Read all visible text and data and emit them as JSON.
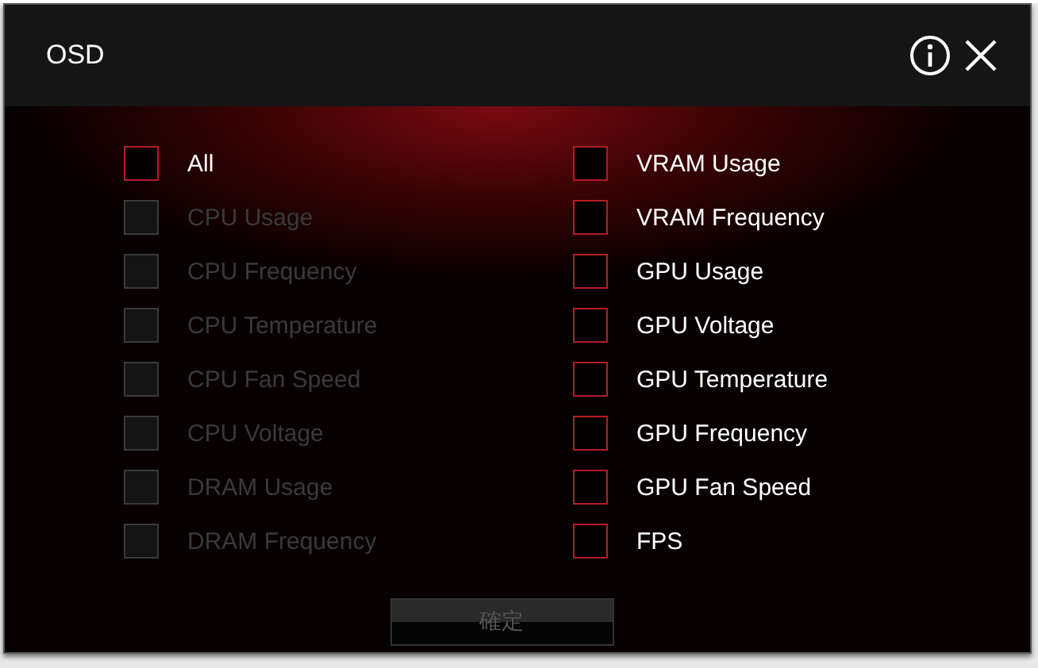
{
  "window": {
    "title": "OSD"
  },
  "left_options": [
    {
      "label": "All",
      "checked": false,
      "disabled": false
    },
    {
      "label": "CPU Usage",
      "checked": false,
      "disabled": true
    },
    {
      "label": "CPU Frequency",
      "checked": false,
      "disabled": true
    },
    {
      "label": "CPU Temperature",
      "checked": false,
      "disabled": true
    },
    {
      "label": "CPU Fan Speed",
      "checked": false,
      "disabled": true
    },
    {
      "label": "CPU Voltage",
      "checked": false,
      "disabled": true
    },
    {
      "label": "DRAM Usage",
      "checked": false,
      "disabled": true
    },
    {
      "label": "DRAM Frequency",
      "checked": false,
      "disabled": true
    }
  ],
  "right_options": [
    {
      "label": "VRAM Usage",
      "checked": false,
      "disabled": false
    },
    {
      "label": "VRAM Frequency",
      "checked": false,
      "disabled": false
    },
    {
      "label": "GPU Usage",
      "checked": false,
      "disabled": false
    },
    {
      "label": "GPU Voltage",
      "checked": false,
      "disabled": false
    },
    {
      "label": "GPU Temperature",
      "checked": false,
      "disabled": false
    },
    {
      "label": "GPU Frequency",
      "checked": false,
      "disabled": false
    },
    {
      "label": "GPU Fan Speed",
      "checked": false,
      "disabled": false
    },
    {
      "label": "FPS",
      "checked": false,
      "disabled": false
    }
  ],
  "confirm_button": {
    "label": "確定",
    "disabled": true
  }
}
